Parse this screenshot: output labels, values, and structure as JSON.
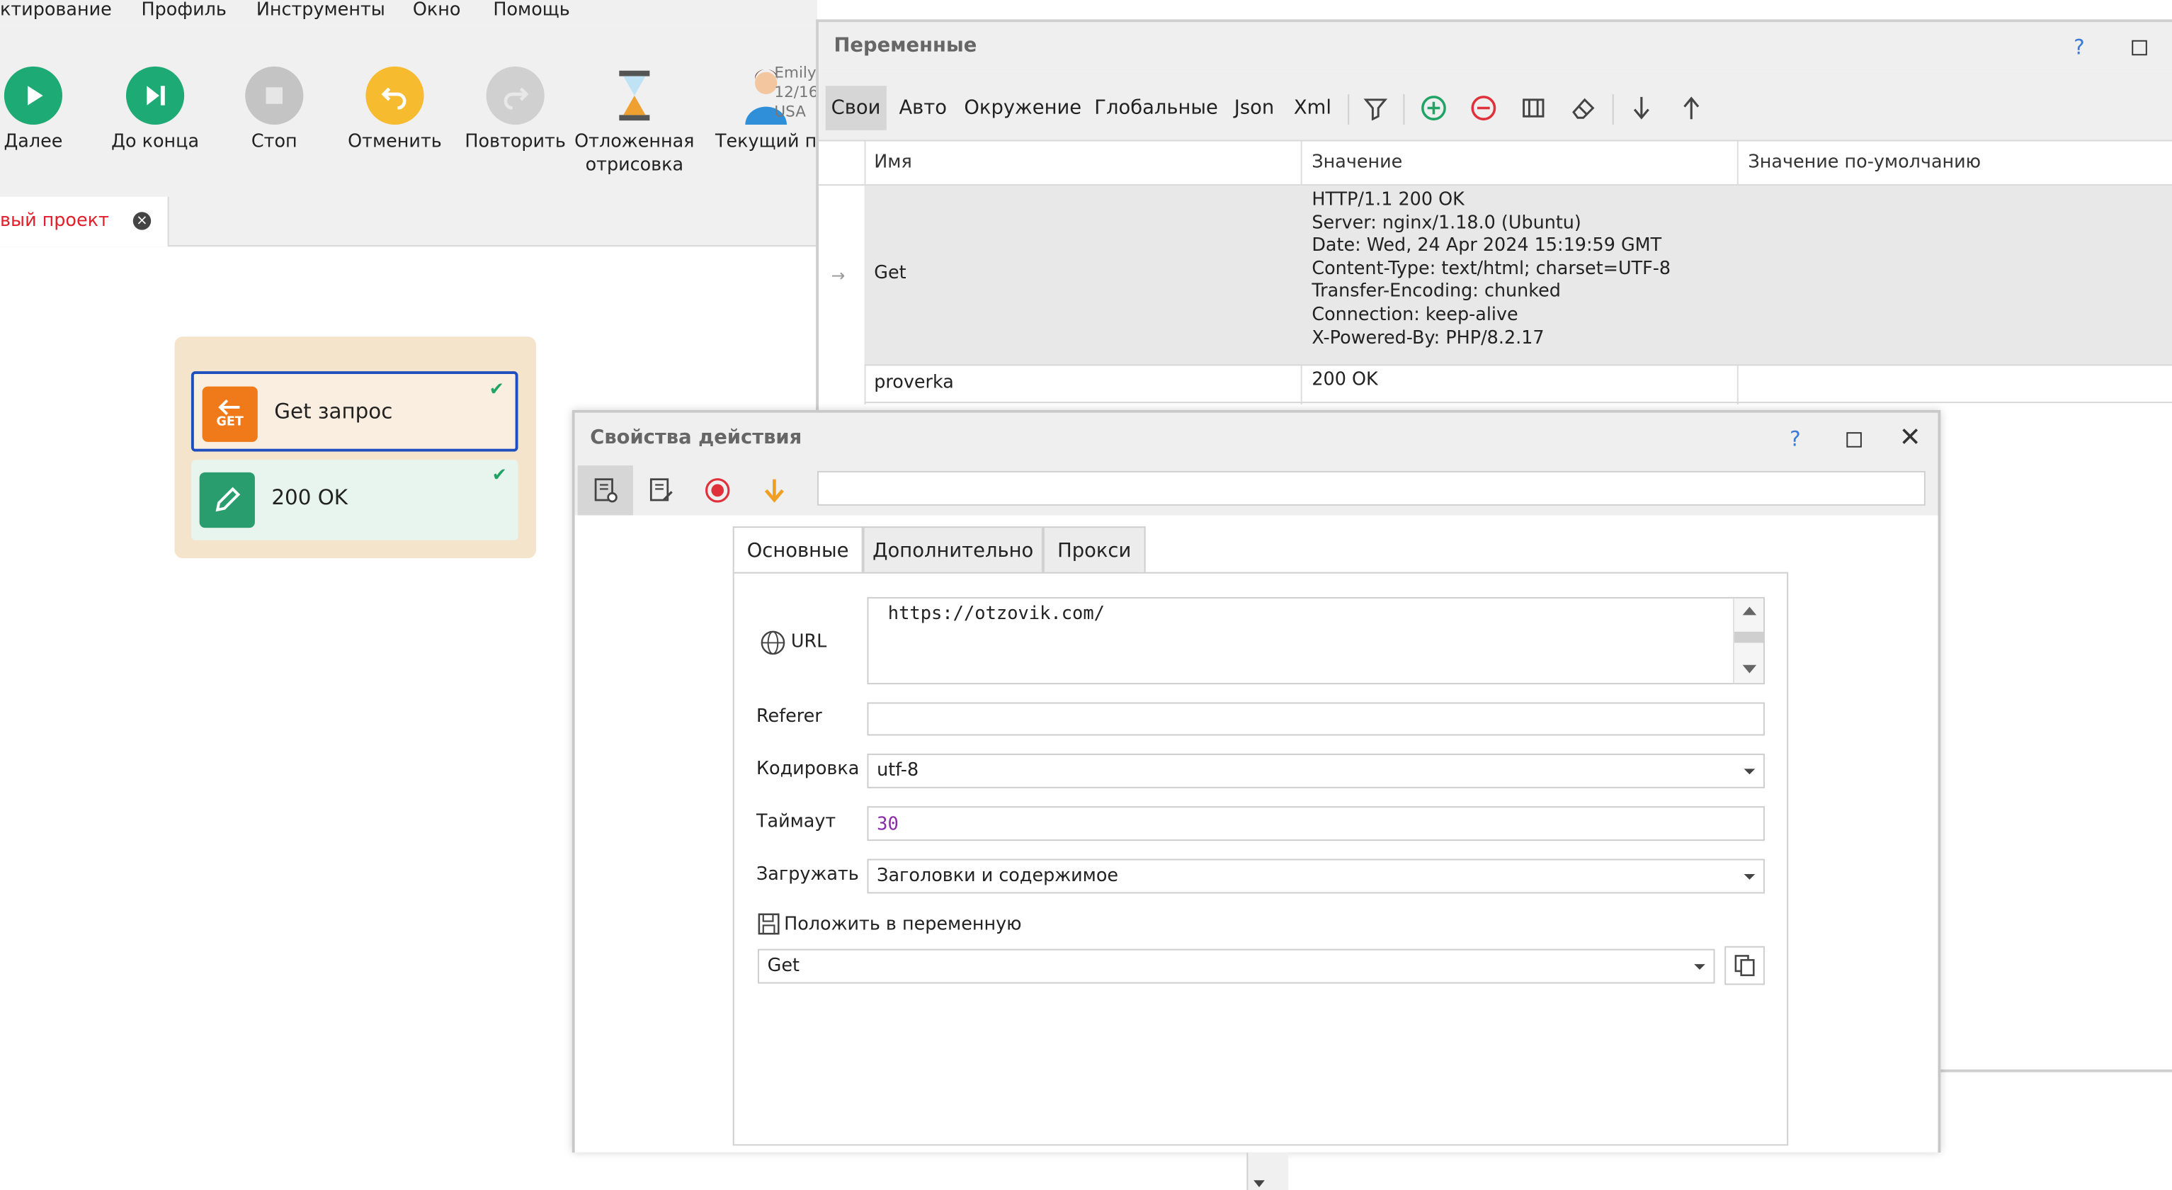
{
  "menu": [
    "ктирование",
    "Профиль",
    "Инструменты",
    "Окно",
    "Помощь"
  ],
  "toolbar": {
    "buttons": [
      {
        "label": "Далее",
        "icon": "play-icon",
        "color": "#1eaa74"
      },
      {
        "label": "До конца",
        "icon": "skip-to-end-icon",
        "color": "#1eaa74"
      },
      {
        "label": "Стоп",
        "icon": "stop-icon",
        "color": "#c4c4c4"
      },
      {
        "label": "Отменить",
        "icon": "undo-icon",
        "color": "#f6bb2e"
      },
      {
        "label": "Повторить",
        "icon": "redo-icon",
        "color": "#d0d0d0"
      },
      {
        "label": "Отложенная отрисовка",
        "icon": "hourglass-icon",
        "color": "#f0a030"
      },
      {
        "label": "Текущий п",
        "icon": "user-avatar-icon",
        "color": "#2f8fd8"
      }
    ],
    "profile_lines": [
      "Emily",
      "12/16",
      "USA"
    ]
  },
  "project_tab": {
    "label": "вый проект"
  },
  "canvas": {
    "actions": [
      {
        "title": "Get запрос",
        "icon": "get-request-icon",
        "icon_text": "GET",
        "color": "#f07a1a"
      },
      {
        "title": "200 OK",
        "icon": "pencil-icon",
        "color": "#2a9d6e"
      }
    ]
  },
  "variables_panel": {
    "title": "Переменные",
    "help": "?",
    "tabs": [
      "Свои",
      "Авто",
      "Окружение",
      "Глобальные",
      "Json",
      "Xml"
    ],
    "columns": [
      "Имя",
      "Значение",
      "Значение по-умолчанию"
    ],
    "rows": [
      {
        "name": "Get",
        "value_lines": [
          "HTTP/1.1 200 OK",
          "Server: nginx/1.18.0 (Ubuntu)",
          "Date: Wed, 24 Apr 2024 15:19:59 GMT",
          "Content-Type: text/html; charset=UTF-8",
          "Transfer-Encoding: chunked",
          "Connection: keep-alive",
          "X-Powered-By: PHP/8.2.17"
        ],
        "default": ""
      },
      {
        "name": "proverka",
        "value_lines": [
          "200 OK"
        ],
        "default": ""
      }
    ]
  },
  "properties_dialog": {
    "title": "Свойства действия",
    "help": "?",
    "tabs": [
      "Основные",
      "Дополнительно",
      "Прокси"
    ],
    "fields": {
      "url_label": "URL",
      "url_value": "https://otzovik.com/",
      "referer_label": "Referer",
      "referer_value": "",
      "encoding_label": "Кодировка",
      "encoding_value": "utf-8",
      "timeout_label": "Таймаут",
      "timeout_value": "30",
      "load_label": "Загружать",
      "load_value": "Заголовки и содержимое",
      "save_to_var_label": "Положить в переменную",
      "save_to_var_value": "Get"
    }
  }
}
